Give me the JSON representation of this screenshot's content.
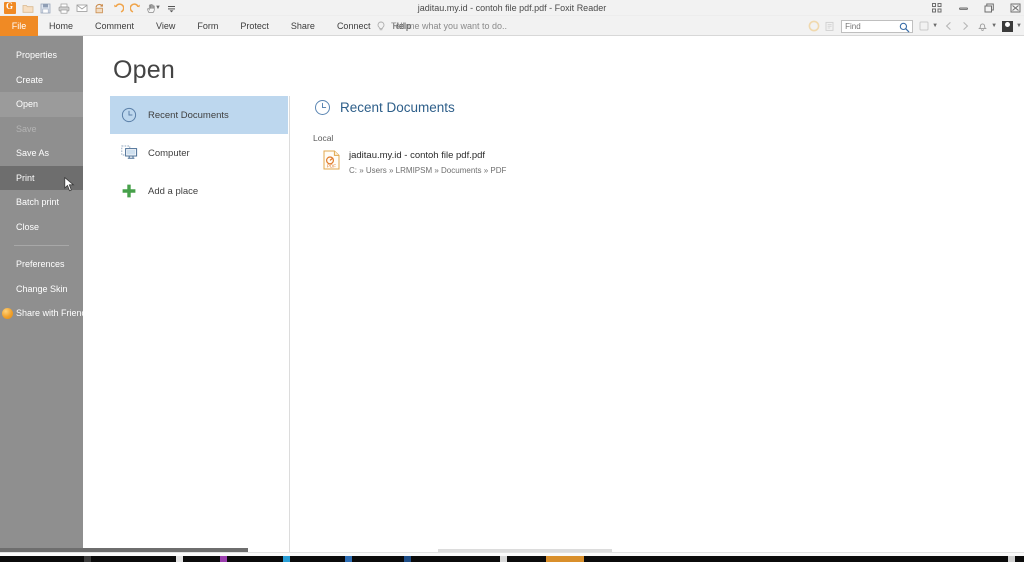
{
  "window": {
    "title": "jaditau.my.id - contoh file pdf.pdf - Foxit Reader",
    "quick_access": [
      {
        "name": "app-logo-icon",
        "label": "G"
      },
      {
        "name": "open-icon",
        "label": "Open"
      },
      {
        "name": "save-icon",
        "label": "Save"
      },
      {
        "name": "print-icon",
        "label": "Print"
      },
      {
        "name": "email-icon",
        "label": "Email"
      },
      {
        "name": "refresh-icon",
        "label": "Refresh"
      },
      {
        "name": "undo-icon",
        "label": "Undo"
      },
      {
        "name": "redo-icon",
        "label": "Redo"
      },
      {
        "name": "hand-tool-icon",
        "label": "Hand Tool"
      },
      {
        "name": "customize-toolbar-icon",
        "label": "Customize"
      }
    ],
    "controls": [
      {
        "name": "app-grid-icon",
        "label": "Apps"
      },
      {
        "name": "minimize-button",
        "label": "Minimize"
      },
      {
        "name": "restore-button",
        "label": "Restore"
      },
      {
        "name": "close-button",
        "label": "Close"
      }
    ]
  },
  "ribbon": {
    "tabs": [
      {
        "label": "File",
        "name": "tab-file",
        "active": true
      },
      {
        "label": "Home",
        "name": "tab-home",
        "active": false
      },
      {
        "label": "Comment",
        "name": "tab-comment",
        "active": false
      },
      {
        "label": "View",
        "name": "tab-view",
        "active": false
      },
      {
        "label": "Form",
        "name": "tab-form",
        "active": false
      },
      {
        "label": "Protect",
        "name": "tab-protect",
        "active": false
      },
      {
        "label": "Share",
        "name": "tab-share",
        "active": false
      },
      {
        "label": "Connect",
        "name": "tab-connect",
        "active": false
      },
      {
        "label": "Help",
        "name": "tab-help",
        "active": false
      }
    ],
    "tell_me": "Tell me what you want to do..",
    "find": {
      "value": "",
      "placeholder": "Find"
    }
  },
  "backstage": {
    "menu": [
      {
        "label": "Properties",
        "name": "menu-item-properties",
        "state": "normal"
      },
      {
        "label": "Create",
        "name": "menu-item-create",
        "state": "normal"
      },
      {
        "label": "Open",
        "name": "menu-item-open",
        "state": "selected"
      },
      {
        "label": "Save",
        "name": "menu-item-save",
        "state": "disabled"
      },
      {
        "label": "Save As",
        "name": "menu-item-save-as",
        "state": "normal"
      },
      {
        "label": "Print",
        "name": "menu-item-print",
        "state": "hovered"
      },
      {
        "label": "Batch print",
        "name": "menu-item-batch-print",
        "state": "normal"
      },
      {
        "label": "Close",
        "name": "menu-item-close",
        "state": "normal"
      },
      {
        "label": "Preferences",
        "name": "menu-item-preferences",
        "state": "normal"
      },
      {
        "label": "Change Skin",
        "name": "menu-item-change-skin",
        "state": "normal"
      },
      {
        "label": "Share with Friends",
        "name": "menu-item-share-with-friends",
        "state": "normal"
      }
    ],
    "page_title": "Open",
    "places": [
      {
        "label": "Recent Documents",
        "name": "place-recent-documents",
        "icon": "clock-icon",
        "selected": true
      },
      {
        "label": "Computer",
        "name": "place-computer",
        "icon": "monitor-icon",
        "selected": false
      },
      {
        "label": "Add a place",
        "name": "place-add-a-place",
        "icon": "plus-icon",
        "selected": false
      }
    ],
    "detail": {
      "title": "Recent Documents",
      "group_label": "Local",
      "items": [
        {
          "name": "jaditau.my.id - contoh file pdf.pdf",
          "path": "C: » Users » LRMIPSM » Documents » PDF"
        }
      ]
    }
  },
  "colors": {
    "accent_orange": "#f08a24",
    "sidebar_grey": "#8f8f8f",
    "selection_blue": "#bdd7ee",
    "heading_blue": "#2e5f8a"
  }
}
